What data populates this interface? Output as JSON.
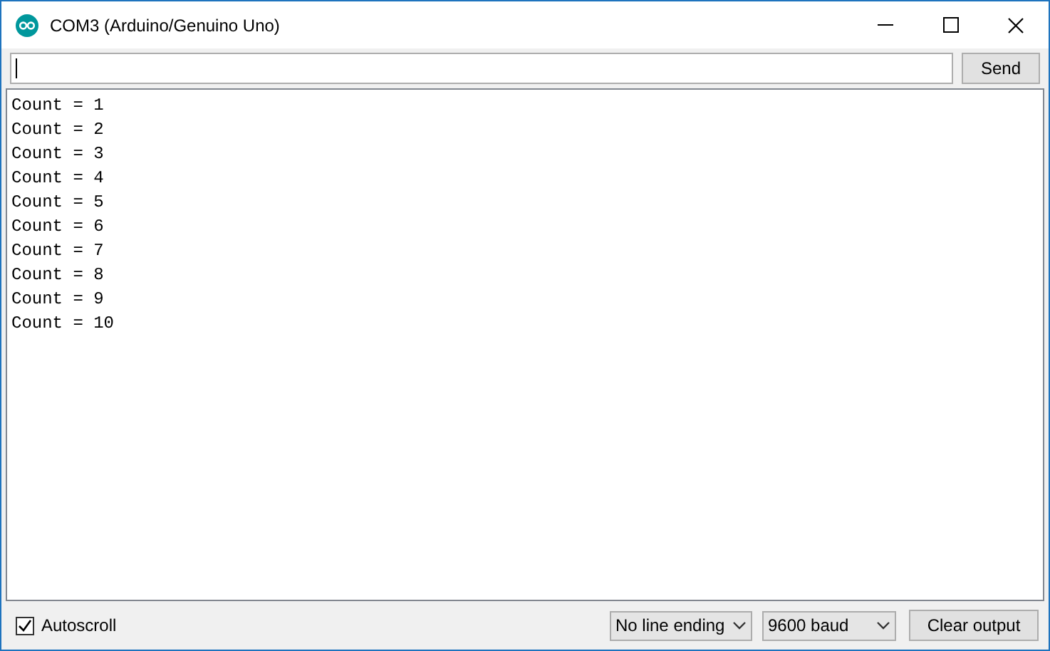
{
  "window": {
    "title": "COM3 (Arduino/Genuino Uno)"
  },
  "send_button": "Send",
  "output_lines": [
    "Count = 1",
    "Count = 2",
    "Count = 3",
    "Count = 4",
    "Count = 5",
    "Count = 6",
    "Count = 7",
    "Count = 8",
    "Count = 9",
    "Count = 10"
  ],
  "autoscroll": {
    "label": "Autoscroll",
    "checked": true
  },
  "line_ending": "No line ending",
  "baud_rate": "9600 baud",
  "clear_button": "Clear output"
}
